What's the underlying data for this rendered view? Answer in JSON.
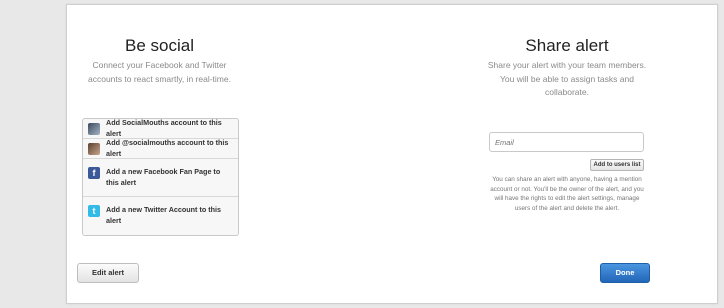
{
  "social": {
    "title": "Be social",
    "subtitle_line1": "Connect your Facebook and Twitter",
    "subtitle_line2": "accounts to react smartly, in real-time.",
    "items": [
      {
        "label": "Add SocialMouths account to this alert",
        "icon": "avatar-socialmouths"
      },
      {
        "label": "Add @socialmouths account to this alert",
        "icon": "avatar-twitter-user"
      },
      {
        "label": "Add a new Facebook Fan Page to this alert",
        "icon": "facebook-icon",
        "glyph": "f"
      },
      {
        "label": "Add a new Twitter Account to this alert",
        "icon": "twitter-icon",
        "glyph": "t"
      }
    ]
  },
  "share": {
    "title": "Share alert",
    "subtitle_line1": "Share your alert with your team members.",
    "subtitle_line2": "You will be able to assign tasks and",
    "subtitle_line3": "collaborate.",
    "email_placeholder": "Email",
    "add_button": "Add to users list",
    "info": "You can share an alert with anyone, having a mention account or not. You'll be the owner of the alert, and you will have the rights to edit the alert settings, manage users of the alert and delete the alert."
  },
  "footer": {
    "edit_label": "Edit alert",
    "done_label": "Done"
  },
  "colors": {
    "facebook": "#3b5998",
    "twitter": "#33bbe8",
    "done_button": "#2f7ad0"
  }
}
